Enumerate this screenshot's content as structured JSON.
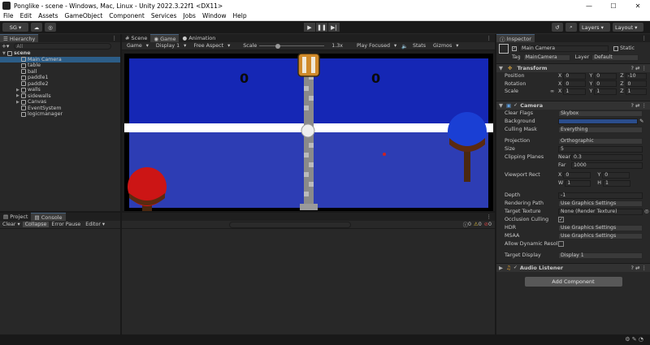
{
  "window": {
    "title": "Ponglike - scene - Windows, Mac, Linux - Unity 2022.3.22f1 <DX11>",
    "min": "—",
    "max": "☐",
    "close": "✕"
  },
  "menu": [
    "File",
    "Edit",
    "Assets",
    "GameObject",
    "Component",
    "Services",
    "Jobs",
    "Window",
    "Help"
  ],
  "toolbar": {
    "account": "SG ▾",
    "layers": "Layers",
    "layout": "Layout"
  },
  "hierarchy": {
    "tab": "Hierarchy",
    "search": "All",
    "scene": "scene",
    "items": [
      {
        "label": "Main Camera",
        "sel": true,
        "exp": false
      },
      {
        "label": "table",
        "sel": false,
        "exp": false
      },
      {
        "label": "ball",
        "sel": false,
        "exp": false
      },
      {
        "label": "paddle1",
        "sel": false,
        "exp": false
      },
      {
        "label": "paddle2",
        "sel": false,
        "exp": false
      },
      {
        "label": "walls",
        "sel": false,
        "exp": true
      },
      {
        "label": "sidewalls",
        "sel": false,
        "exp": true
      },
      {
        "label": "Canvas",
        "sel": false,
        "exp": true
      },
      {
        "label": "EventSystem",
        "sel": false,
        "exp": false
      },
      {
        "label": "logicmanager",
        "sel": false,
        "exp": false
      }
    ]
  },
  "viewtabs": {
    "scene": "Scene",
    "game": "Game",
    "animation": "Animation"
  },
  "gametools": {
    "game": "Game",
    "display": "Display 1",
    "aspect": "Free Aspect",
    "scale": "Scale",
    "scale_val": "1.3x",
    "play": "Play Focused",
    "stats": "Stats",
    "gizmos": "Gizmos"
  },
  "game": {
    "score_left": "0",
    "score_right": "0"
  },
  "console": {
    "tab_project": "Project",
    "tab_console": "Console",
    "clear": "Clear",
    "collapse": "Collapse",
    "error_pause": "Error Pause",
    "editor": "Editor",
    "c1": "0",
    "c2": "0",
    "c3": "0"
  },
  "inspector": {
    "tab": "Inspector",
    "name": "Main Camera",
    "static": "Static",
    "tag_lbl": "Tag",
    "tag": "MainCamera",
    "layer_lbl": "Layer",
    "layer": "Default",
    "transform": {
      "title": "Transform",
      "rows": [
        {
          "label": "Position",
          "x": "0",
          "y": "0",
          "z": "-10"
        },
        {
          "label": "Rotation",
          "x": "0",
          "y": "0",
          "z": "0"
        },
        {
          "label": "Scale",
          "x": "1",
          "y": "1",
          "z": "1"
        }
      ]
    },
    "camera": {
      "title": "Camera",
      "clear_flags_l": "Clear Flags",
      "clear_flags": "Skybox",
      "background_l": "Background",
      "culling_l": "Culling Mask",
      "culling": "Everything",
      "projection_l": "Projection",
      "projection": "Orthographic",
      "size_l": "Size",
      "size": "5",
      "clip_l": "Clipping Planes",
      "near_l": "Near",
      "near": "0.3",
      "far_l": "Far",
      "far": "1000",
      "vp_l": "Viewport Rect",
      "vx": "0",
      "vy": "0",
      "vw": "1",
      "vh": "1",
      "depth_l": "Depth",
      "depth": "-1",
      "rpath_l": "Rendering Path",
      "rpath": "Use Graphics Settings",
      "ttex_l": "Target Texture",
      "ttex": "None (Render Texture)",
      "occ_l": "Occlusion Culling",
      "hdr_l": "HDR",
      "hdr": "Use Graphics Settings",
      "msaa_l": "MSAA",
      "msaa": "Use Graphics Settings",
      "adr_l": "Allow Dynamic Resol",
      "tdisp_l": "Target Display",
      "tdisp": "Display 1"
    },
    "audio": "Audio Listener",
    "add_component": "Add Component"
  },
  "colors": {
    "accent": "#2c5d87",
    "table_blue": "#1527b5",
    "table_blue2": "#2d3db4",
    "paddle_red": "#cc1515",
    "paddle_blue": "#1a3fd4"
  }
}
